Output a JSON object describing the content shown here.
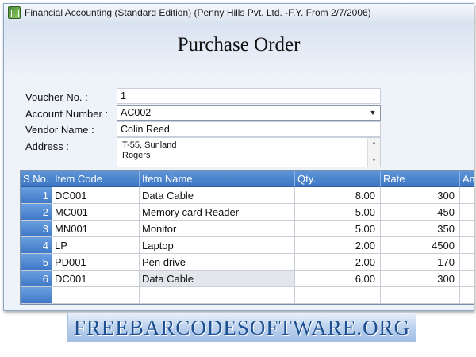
{
  "window": {
    "title": "Financial Accounting (Standard Edition) (Penny Hills Pvt. Ltd. -F.Y. From 2/7/2006)"
  },
  "form": {
    "heading": "Purchase Order",
    "voucher_label": "Voucher No. :",
    "voucher_value": "1",
    "account_label": "Account Number :",
    "account_value": "AC002",
    "vendor_label": "Vendor Name :",
    "vendor_value": "Colin Reed",
    "address_label": "Address :",
    "address_lines": [
      "T-55, Sunland",
      "Rogers"
    ]
  },
  "grid": {
    "columns": [
      "S.No.",
      "Item Code",
      "Item Name",
      "Qty.",
      "Rate",
      "Am"
    ],
    "rows": [
      {
        "sno": "1",
        "code": "DC001",
        "name": "Data Cable",
        "qty": "8.00",
        "rate": "300"
      },
      {
        "sno": "2",
        "code": "MC001",
        "name": "Memory card Reader",
        "qty": "5.00",
        "rate": "450"
      },
      {
        "sno": "3",
        "code": "MN001",
        "name": "Monitor",
        "qty": "5.00",
        "rate": "350"
      },
      {
        "sno": "4",
        "code": "LP",
        "name": "Laptop",
        "qty": "2.00",
        "rate": "4500"
      },
      {
        "sno": "5",
        "code": "PD001",
        "name": "Pen drive",
        "qty": "2.00",
        "rate": "170"
      },
      {
        "sno": "6",
        "code": "DC001",
        "name": "Data Cable",
        "qty": "6.00",
        "rate": "300"
      }
    ]
  },
  "banner": {
    "text": "FREEBARCODESOFTWARE.ORG"
  }
}
